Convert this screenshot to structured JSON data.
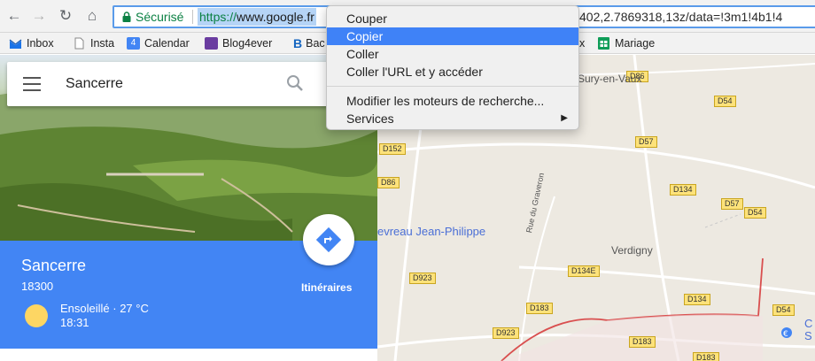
{
  "browser": {
    "secure_label": "Sécurisé",
    "url_protocol": "https://",
    "url_host": "www.google.fr",
    "url_tail": "402,2.7869318,13z/data=!3m1!4b1!4"
  },
  "bookmarks": [
    {
      "label": "Inbox",
      "icon": "mail-icon",
      "color": "#1a73e8"
    },
    {
      "label": "Insta",
      "icon": "page-icon",
      "color": "#888888"
    },
    {
      "label": "Calendar",
      "icon": "calendar-icon",
      "color": "#4285f4",
      "badge": "4"
    },
    {
      "label": "Blog4ever",
      "icon": "blog-icon",
      "color": "#6a3ca0"
    },
    {
      "label": "Bac",
      "icon": "b-icon",
      "color": "#1565c0"
    },
    {
      "label": "x",
      "icon": "",
      "color": ""
    },
    {
      "label": "Mariage",
      "icon": "sheet-icon",
      "color": "#0f9d58"
    }
  ],
  "search": {
    "value": "Sancerre"
  },
  "place": {
    "name": "Sancerre",
    "postcode": "18300",
    "weather": "Ensoleillé · 27 °C",
    "time": "18:31",
    "directions_label": "Itinéraires"
  },
  "map": {
    "roads": [
      {
        "label": "D86"
      },
      {
        "label": "D54"
      },
      {
        "label": "D57"
      },
      {
        "label": "D152"
      },
      {
        "label": "D86"
      },
      {
        "label": "D134"
      },
      {
        "label": "D57"
      },
      {
        "label": "D54"
      },
      {
        "label": "D923"
      },
      {
        "label": "D134E"
      },
      {
        "label": "D183"
      },
      {
        "label": "D134"
      },
      {
        "label": "D54"
      },
      {
        "label": "D923"
      },
      {
        "label": "D183"
      },
      {
        "label": "D183"
      }
    ],
    "texts": {
      "sury": "Sury-en-Vaux",
      "chevreau": "evreau Jean-Philippe",
      "verdigny": "Verdigny",
      "rue_graveron": "Rue du Graveron",
      "edge_c": "C",
      "edge_s": "S"
    }
  },
  "context_menu": {
    "items": [
      "Couper",
      "Copier",
      "Coller",
      "Coller l'URL et y accéder"
    ],
    "items2": [
      "Modifier les moteurs de recherche...",
      "Services"
    ],
    "active_index": 1
  }
}
